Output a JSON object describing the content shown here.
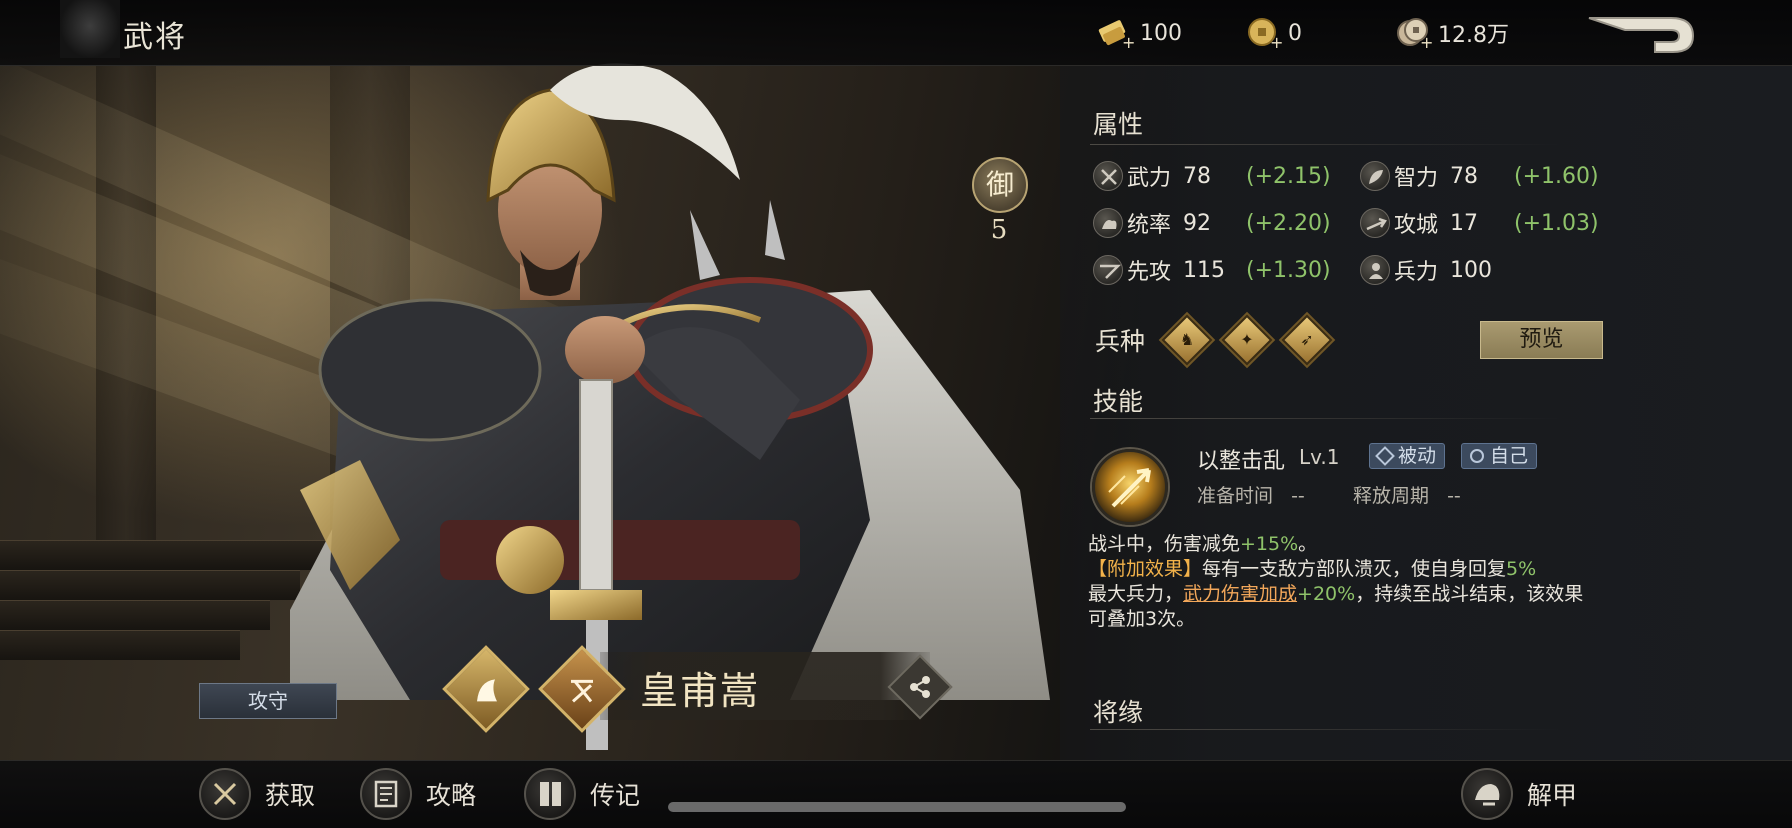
{
  "header": {
    "title": "武将",
    "currencies": [
      {
        "icon": "gold-ingot-icon",
        "amount": "100"
      },
      {
        "icon": "gold-coin-icon",
        "amount": "0"
      },
      {
        "icon": "copper-coin-icon",
        "amount": "12.8万"
      }
    ]
  },
  "hero": {
    "name": "皇甫嵩",
    "rank_char": "御",
    "rank_level": "5",
    "role": "攻守"
  },
  "attributes": {
    "title": "属性",
    "items": [
      {
        "icon": "sword-icon",
        "name": "武力",
        "value": "78",
        "bonus": "(+2.15)"
      },
      {
        "icon": "intellect-icon",
        "name": "智力",
        "value": "78",
        "bonus": "(+1.60)"
      },
      {
        "icon": "command-icon",
        "name": "统率",
        "value": "92",
        "bonus": "(+2.20)"
      },
      {
        "icon": "siege-icon",
        "name": "攻城",
        "value": "17",
        "bonus": "(+1.03)"
      },
      {
        "icon": "speed-icon",
        "name": "先攻",
        "value": "115",
        "bonus": "(+1.30)"
      },
      {
        "icon": "troops-icon",
        "name": "兵力",
        "value": "100",
        "bonus": ""
      }
    ]
  },
  "troop_types": {
    "title": "兵种",
    "items": [
      "cavalry-icon",
      "shield-icon",
      "archer-icon"
    ],
    "preview_label": "预览"
  },
  "skills": {
    "title": "技能",
    "name": "以整击乱",
    "level": "Lv.1",
    "tags": [
      "被动",
      "自己"
    ],
    "prep_label": "准备时间",
    "prep_value": "--",
    "cycle_label": "释放周期",
    "cycle_value": "--",
    "desc_1a": "战斗中，伤害减免",
    "desc_1b": "+15%",
    "desc_1c": "。",
    "desc_2a": "【附加效果】",
    "desc_2b": "每有一支敌方部队溃灭，使自身回复",
    "desc_2c": "5%",
    "desc_2d": "最大兵力，",
    "desc_2e": "武力伤害加成",
    "desc_2f": "+20%",
    "desc_2g": "，持续至战斗结束，该效果可叠加3次。"
  },
  "bonds": {
    "title": "将缘"
  },
  "bottom_nav": [
    {
      "icon": "obtain-icon",
      "label": "获取"
    },
    {
      "icon": "guide-icon",
      "label": "攻略"
    },
    {
      "icon": "biography-icon",
      "label": "传记"
    },
    {
      "icon": "unarmor-icon",
      "label": "解甲"
    }
  ],
  "colors": {
    "bonus_green": "#8fc36a",
    "gold_accent": "#d3b369",
    "tag_blue": "#3c4a5e"
  }
}
